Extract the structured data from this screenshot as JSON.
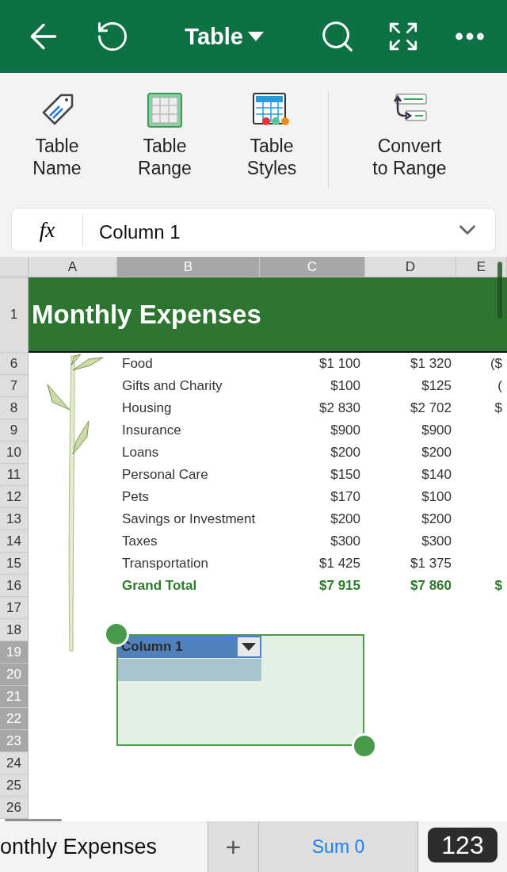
{
  "toolbar": {
    "title": "Table"
  },
  "ribbon": [
    {
      "label": "Table Name"
    },
    {
      "label": "Table Range"
    },
    {
      "label": "Table Styles"
    },
    {
      "label": "Convert to Range"
    }
  ],
  "formula_bar": {
    "label": "fx",
    "value": "Column 1"
  },
  "columns": [
    {
      "label": "A",
      "selected": false
    },
    {
      "label": "B",
      "selected": true
    },
    {
      "label": "C",
      "selected": true
    },
    {
      "label": "D",
      "selected": false
    },
    {
      "label": "E",
      "selected": false
    }
  ],
  "title_row": {
    "number": "1",
    "text": "Monthly Expenses"
  },
  "rows": [
    {
      "number": "6",
      "selected": false,
      "kind": "item",
      "cells": [
        "Food",
        "$1 100",
        "$1 320",
        "($"
      ]
    },
    {
      "number": "7",
      "selected": false,
      "kind": "item",
      "cells": [
        "Gifts and Charity",
        "$100",
        "$125",
        "("
      ]
    },
    {
      "number": "8",
      "selected": false,
      "kind": "item",
      "cells": [
        "Housing",
        "$2 830",
        "$2 702",
        "$"
      ]
    },
    {
      "number": "9",
      "selected": false,
      "kind": "item",
      "cells": [
        "Insurance",
        "$900",
        "$900"
      ]
    },
    {
      "number": "10",
      "selected": false,
      "kind": "item",
      "cells": [
        "Loans",
        "$200",
        "$200"
      ]
    },
    {
      "number": "11",
      "selected": false,
      "kind": "item",
      "cells": [
        "Personal Care",
        "$150",
        "$140"
      ]
    },
    {
      "number": "12",
      "selected": false,
      "kind": "item",
      "cells": [
        "Pets",
        "$170",
        "$100"
      ]
    },
    {
      "number": "13",
      "selected": false,
      "kind": "item",
      "cells": [
        "Savings or Investment",
        "$200",
        "$200"
      ]
    },
    {
      "number": "14",
      "selected": false,
      "kind": "item",
      "cells": [
        "Taxes",
        "$300",
        "$300"
      ]
    },
    {
      "number": "15",
      "selected": false,
      "kind": "item",
      "cells": [
        "Transportation",
        "$1 425",
        "$1 375"
      ]
    },
    {
      "number": "16",
      "selected": false,
      "kind": "total",
      "cells": [
        "Grand Total",
        "$7 915",
        "$7 860",
        "$"
      ]
    },
    {
      "number": "17",
      "selected": false,
      "kind": "item",
      "cells": []
    },
    {
      "number": "18",
      "selected": false,
      "kind": "item",
      "cells": []
    },
    {
      "number": "19",
      "selected": true,
      "kind": "item",
      "cells": []
    },
    {
      "number": "20",
      "selected": true,
      "kind": "item",
      "cells": []
    },
    {
      "number": "21",
      "selected": true,
      "kind": "item",
      "cells": []
    },
    {
      "number": "22",
      "selected": true,
      "kind": "item",
      "cells": []
    },
    {
      "number": "23",
      "selected": true,
      "kind": "item",
      "cells": []
    },
    {
      "number": "24",
      "selected": false,
      "kind": "item",
      "cells": []
    },
    {
      "number": "25",
      "selected": false,
      "kind": "item",
      "cells": []
    },
    {
      "number": "26",
      "selected": false,
      "kind": "item",
      "cells": []
    }
  ],
  "table": {
    "header": "Column 1"
  },
  "status_bar": {
    "sheet_tab": "onthly Expenses",
    "add": "+",
    "sum": "Sum 0",
    "keyboard": "123"
  }
}
